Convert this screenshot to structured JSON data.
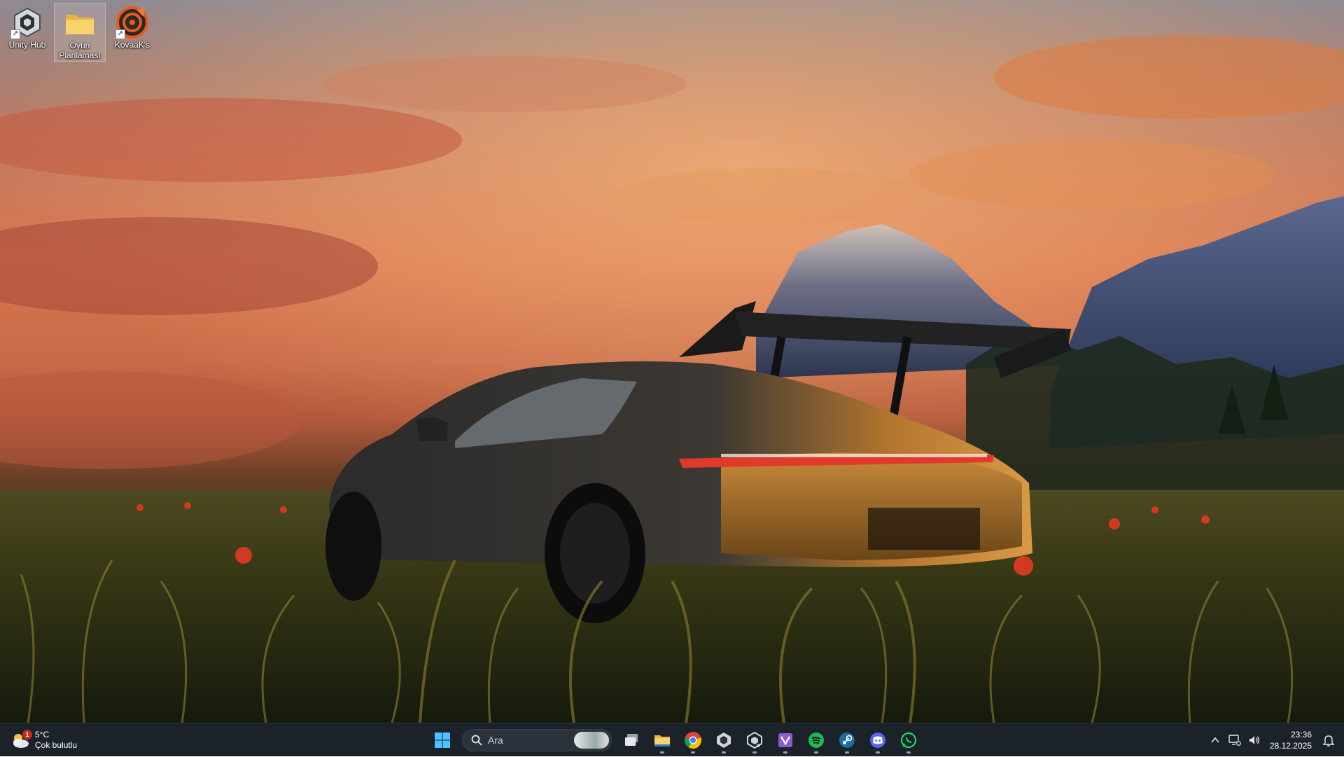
{
  "desktop": {
    "icons": [
      {
        "label": "Unity Hub",
        "icon": "unity-hub-icon",
        "shortcut": true
      },
      {
        "label": "Oyun Planlaması",
        "icon": "folder-icon",
        "shortcut": false
      },
      {
        "label": "KovaaK's",
        "icon": "kovaaks-icon",
        "shortcut": true
      }
    ]
  },
  "taskbar": {
    "weather": {
      "temp": "5°C",
      "condition": "Çok bulutlu",
      "badge": "1"
    },
    "search": {
      "placeholder": "Ara"
    },
    "apps": [
      {
        "name": "start-button",
        "icon": "windows-logo-icon",
        "running": false
      },
      {
        "name": "task-view-button",
        "icon": "task-view-icon",
        "running": false
      },
      {
        "name": "file-explorer-button",
        "icon": "folder-icon",
        "running": true
      },
      {
        "name": "chrome-button",
        "icon": "chrome-icon",
        "running": true
      },
      {
        "name": "unity-hub-button",
        "icon": "unity-hub-icon",
        "running": true
      },
      {
        "name": "unity-editor-button",
        "icon": "unity-editor-icon",
        "running": true
      },
      {
        "name": "visual-studio-button",
        "icon": "visual-studio-icon",
        "running": true
      },
      {
        "name": "spotify-button",
        "icon": "spotify-icon",
        "running": true
      },
      {
        "name": "steam-button",
        "icon": "steam-icon",
        "running": true
      },
      {
        "name": "discord-button",
        "icon": "discord-icon",
        "running": true
      },
      {
        "name": "whatsapp-button",
        "icon": "whatsapp-icon",
        "running": true
      }
    ],
    "tray": {
      "time": "23:36",
      "date": "28.12.2025"
    }
  },
  "colors": {
    "taskbar_bg": "#1c2229",
    "accent_blue": "#0078d4",
    "spotify": "#1db954",
    "discord": "#5865f2",
    "whatsapp": "#25d366"
  }
}
